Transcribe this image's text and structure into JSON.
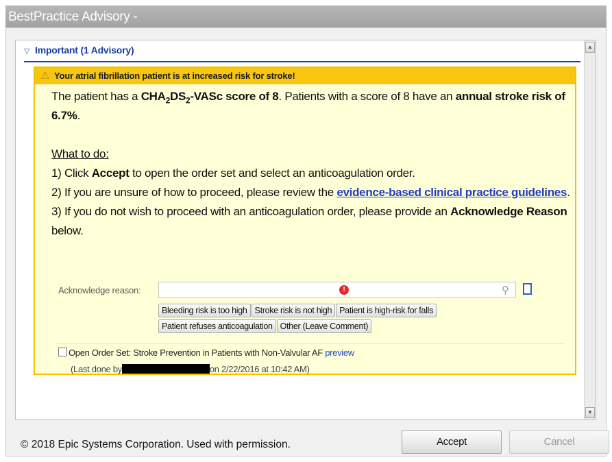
{
  "window": {
    "title": "BestPractice Advisory -"
  },
  "section": {
    "label": "Important (1 Advisory)"
  },
  "advisory": {
    "header_text": "Your atrial fibrillation patient is at increased risk for stroke!",
    "score_line": {
      "prefix": "The patient has a ",
      "cha": "CHA",
      "sub1": "2",
      "ds": "DS",
      "sub2": "2",
      "vasc": "-VASc score of 8",
      "middle": ".  Patients with a score of 8 have an ",
      "risk_bold": "annual stroke risk of 6.7%",
      "end": "."
    },
    "what_to_do": "What to do:",
    "step1": {
      "prefix": "1) Click ",
      "bold": "Accept",
      "suffix": " to open the order set and select an anticoagulation order."
    },
    "step2": {
      "prefix": "2) If you are unsure of how to proceed, please review the ",
      "link": "evidence-based clinical practice guidelines",
      "suffix": "."
    },
    "step3": {
      "prefix": "3) If you do not wish to proceed with an anticoagulation order, please provide an ",
      "bold": "Acknowledge Reason",
      "suffix": " below."
    }
  },
  "acknowledge": {
    "label": "Acknowledge reason:",
    "value": "",
    "reasons": [
      "Bleeding risk is too high",
      "Stroke risk is not high",
      "Patient is high-risk for falls",
      "Patient refuses anticoagulation",
      "Other (Leave Comment)"
    ]
  },
  "order_set": {
    "checkbox_label": "Open Order Set:",
    "name": "Stroke Prevention in Patients with Non-Valvular AF",
    "preview": "preview",
    "last_done_prefix": "(Last done by",
    "last_done_suffix": "on 2/22/2016 at 10:42 AM)"
  },
  "footer": {
    "copyright": "© 2018 Epic Systems Corporation. Used with permission.",
    "accept_label": "Accept",
    "cancel_label": "Cancel"
  },
  "colors": {
    "accent_blue": "#1f3ea8",
    "advisory_bg": "#ffffd8",
    "advisory_header": "#f7c610"
  }
}
